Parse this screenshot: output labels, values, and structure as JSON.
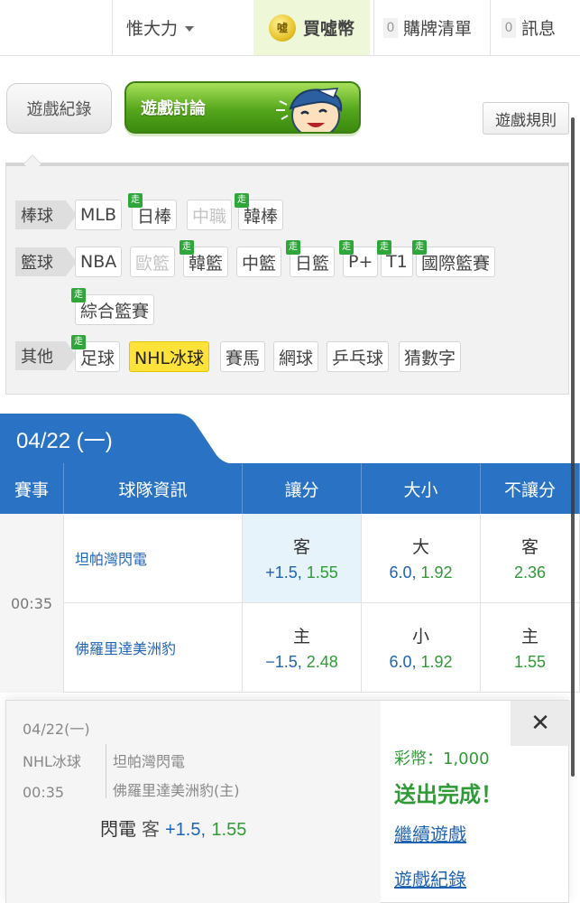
{
  "topbar": {
    "username": "惟大力",
    "coin_label": "買噓幣",
    "coin_icon_text": "噓",
    "cart_count": "0",
    "cart_label": "購牌清單",
    "msg_count": "0",
    "msg_label": "訊息"
  },
  "tabs": {
    "record": "遊戲紀錄",
    "discuss": "遊戲討論",
    "rules": "遊戲規則"
  },
  "categories": {
    "baseball": {
      "label": "棒球",
      "items": [
        "MLB",
        "日棒",
        "中職",
        "韓棒"
      ]
    },
    "basketball": {
      "label": "籃球",
      "items": [
        "NBA",
        "歐籃",
        "韓籃",
        "中籃",
        "日籃",
        "P+",
        "T1",
        "國際籃賽",
        "綜合籃賽"
      ]
    },
    "other": {
      "label": "其他",
      "items": [
        "足球",
        "NHL冰球",
        "賽馬",
        "網球",
        "乒乓球",
        "猜數字"
      ]
    },
    "walk_badge": "走"
  },
  "date_header": "04/22 (一)",
  "table": {
    "headers": [
      "賽事",
      "球隊資訊",
      "讓分",
      "大小",
      "不讓分"
    ],
    "time": "00:35",
    "rows": [
      {
        "team": "坦帕灣閃電",
        "spread_side": "客",
        "spread_line": "+1.5,",
        "spread_price": "1.55",
        "total_side": "大",
        "total_line": "6.0,",
        "total_price": "1.92",
        "ml_side": "客",
        "ml_price": "2.36"
      },
      {
        "team": "佛羅里達美洲豹",
        "spread_side": "主",
        "spread_line": "−1.5,",
        "spread_price": "2.48",
        "total_side": "小",
        "total_line": "6.0,",
        "total_price": "1.92",
        "ml_side": "主",
        "ml_price": "1.55"
      }
    ]
  },
  "slip": {
    "date": "04/22(一)",
    "sport": "NHL冰球",
    "time": "00:35",
    "away": "坦帕灣閃電",
    "home": "佛羅里達美洲豹(主)",
    "pick_team": "閃電",
    "pick_side": "客",
    "pick_line": "+1.5,",
    "pick_price": "1.55",
    "close": "✕",
    "cost": "彩幣：1,000",
    "done": "送出完成！",
    "continue": "繼續遊戲",
    "records": "遊戲紀錄"
  },
  "colors": {
    "header_blue": "#2a72c4",
    "accent_green": "#54a61b",
    "link_blue": "#1f63b4",
    "price_green": "#2f9a36",
    "active_chip": "#ffe23a"
  }
}
